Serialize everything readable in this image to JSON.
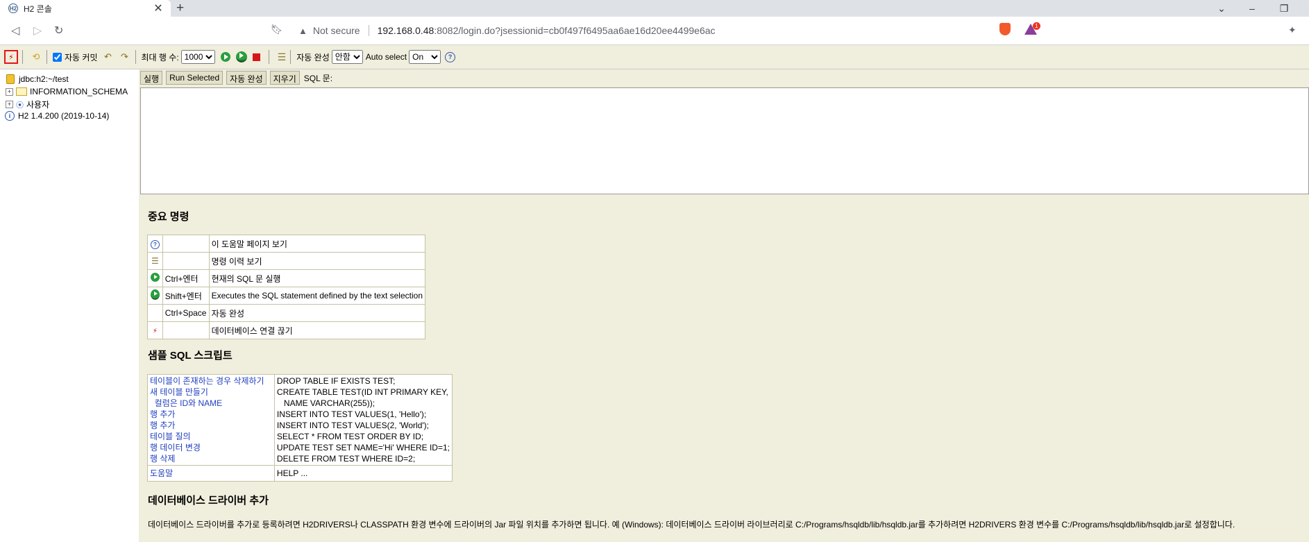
{
  "browser": {
    "tab_title": "H2 콘솔",
    "url_host": "192.168.0.48",
    "url_rest": ":8082/login.do?jsessionid=cb0f497f6495aa6ae16d20ee4499e6ac",
    "security_text": "Not secure",
    "badge_count": "1"
  },
  "toolbar": {
    "auto_commit_label": "자동 커밋",
    "max_rows_label": "최대 행 수:",
    "max_rows_value": "1000",
    "autocomplete_label": "자동 완성",
    "autocomplete_value": "안함",
    "auto_select_label": "Auto select",
    "auto_select_value": "On"
  },
  "tree": {
    "connection": "jdbc:h2:~/test",
    "schema": "INFORMATION_SCHEMA",
    "users": "사용자",
    "version": "H2 1.4.200 (2019-10-14)"
  },
  "query": {
    "run_label": "실행",
    "run_selected_label": "Run Selected",
    "autocomplete_label": "자동 완성",
    "clear_label": "지우기",
    "sql_label": "SQL 문:"
  },
  "help": {
    "important_title": "중요 명령",
    "rows": [
      {
        "key": "",
        "desc": "이 도움말 페이지 보기"
      },
      {
        "key": "",
        "desc": "명령 이력 보기"
      },
      {
        "key": "Ctrl+엔터",
        "desc": "현재의 SQL 문 실행"
      },
      {
        "key": "Shift+엔터",
        "desc": "Executes the SQL statement defined by the text selection"
      },
      {
        "key": "Ctrl+Space",
        "desc": "자동 완성"
      },
      {
        "key": "",
        "desc": "데이터베이스 연결 끊기"
      }
    ],
    "sample_title": "샘플 SQL 스크립트",
    "samples_left": [
      "테이블이 존재하는 경우 삭제하기",
      "새 테이블 만들기",
      "  컬럼은 ID와 NAME",
      "행 추가",
      "행 추가",
      "테이블 질의",
      "행 데이터 변경",
      "행 삭제"
    ],
    "samples_right": [
      "DROP TABLE IF EXISTS TEST;",
      "CREATE TABLE TEST(ID INT PRIMARY KEY,",
      "   NAME VARCHAR(255));",
      "INSERT INTO TEST VALUES(1, 'Hello');",
      "INSERT INTO TEST VALUES(2, 'World');",
      "SELECT * FROM TEST ORDER BY ID;",
      "UPDATE TEST SET NAME='Hi' WHERE ID=1;",
      "DELETE FROM TEST WHERE ID=2;"
    ],
    "help_link": "도움말",
    "help_cmd": "HELP ...",
    "driver_title": "데이터베이스 드라이버 추가",
    "driver_text": "데이터베이스 드라이버를 추가로 등록하려면 H2DRIVERS나 CLASSPATH 환경 변수에 드라이버의 Jar 파일 위치를 추가하면 됩니다. 예 (Windows): 데이터베이스 드라이버 라이브러리로 C:/Programs/hsqldb/lib/hsqldb.jar를 추가하려면 H2DRIVERS 환경 변수를 C:/Programs/hsqldb/lib/hsqldb.jar로 설정합니다."
  }
}
